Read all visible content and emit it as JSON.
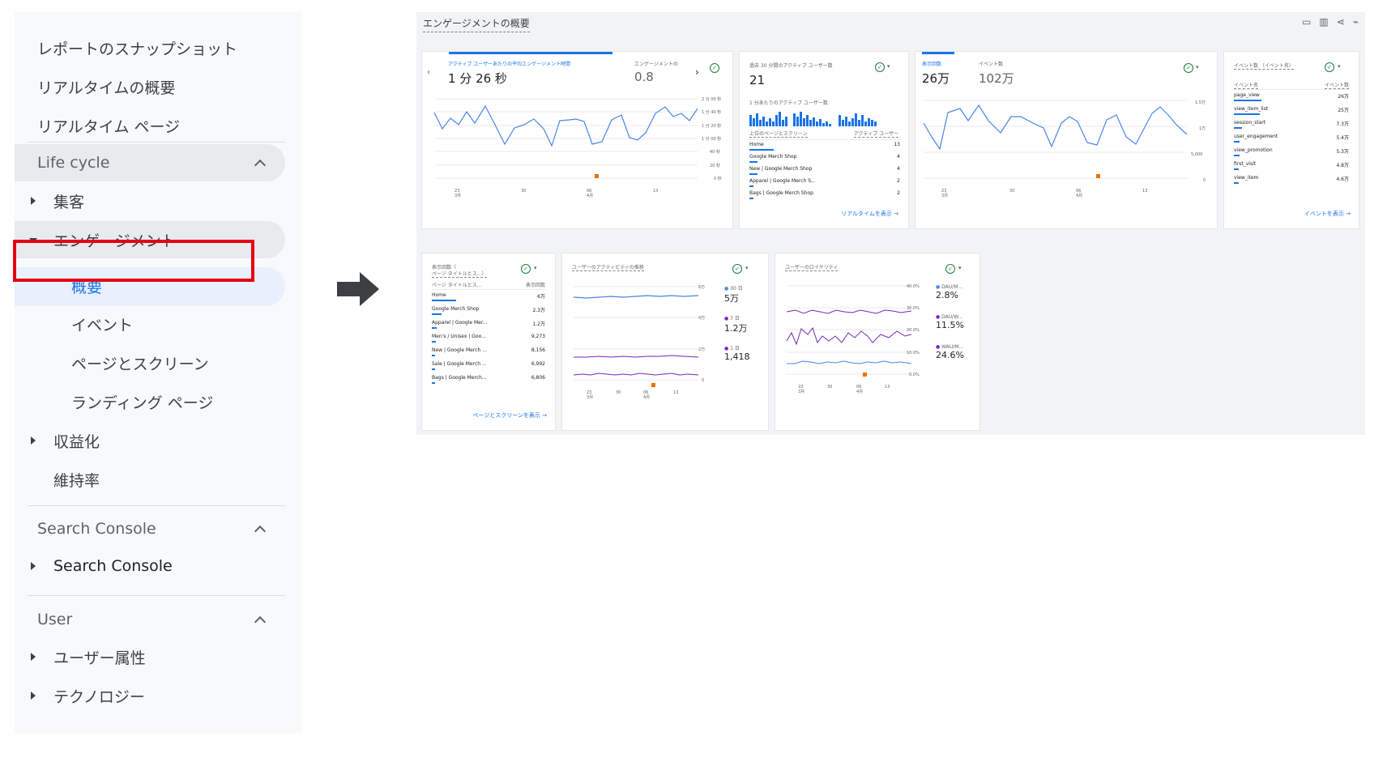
{
  "sidebar": {
    "top_items": [
      "レポートのスナップショット",
      "リアルタイムの概要",
      "リアルタイム ページ"
    ],
    "lifecycle": {
      "header": "Life cycle",
      "acquisition": "集客",
      "engagement": "エンゲージメント",
      "engagement_children": [
        "概要",
        "イベント",
        "ページとスクリーン",
        "ランディング ページ"
      ],
      "monetization": "収益化",
      "retention": "維持率"
    },
    "search_console": {
      "header": "Search Console",
      "item": "Search Console"
    },
    "user": {
      "header": "User",
      "items": [
        "ユーザー属性",
        "テクノロジー"
      ]
    }
  },
  "panel": {
    "title": "エンゲージメントの概要",
    "card1": {
      "metric1_label": "アクティブ ユーザーあたりの平均エンゲージメント時間",
      "metric1_value": "1 分 26 秒",
      "metric2_label": "エンゲージメントの",
      "metric2_value": "0.8",
      "y_ticks": [
        "2 分 00 秒",
        "1 分 40 秒",
        "1 分 20 秒",
        "1 分 00 秒",
        "40 秒",
        "20 秒",
        "0 秒"
      ],
      "x_ticks": [
        "23",
        "30",
        "06",
        "13"
      ],
      "x_sub": [
        "3月",
        "4月"
      ]
    },
    "card2": {
      "title": "過去 30 分間のアクティブ ユーザー数",
      "value": "21",
      "sub_title": "1 分あたりのアクティブ ユーザー数",
      "col1": "上位のページとスクリーン",
      "col2": "アクティブ ユーザー",
      "rows": [
        {
          "name": "Home",
          "value": "13"
        },
        {
          "name": "Google Merch Shop",
          "value": "4"
        },
        {
          "name": "New | Google Merch Shop",
          "value": "4"
        },
        {
          "name": "Apparel | Google Merch S...",
          "value": "2"
        },
        {
          "name": "Bags | Google Merch Shop",
          "value": "2"
        }
      ],
      "link": "リアルタイムを表示"
    },
    "card3": {
      "metric1_label": "表示回数",
      "metric1_value": "26万",
      "metric2_label": "イベント数",
      "metric2_value": "102万",
      "y_ticks": [
        "1.5万",
        "1万",
        "5,000",
        "0"
      ],
      "x_ticks": [
        "23",
        "30",
        "06",
        "13"
      ],
      "x_sub": [
        "3月",
        "4月"
      ]
    },
    "card4": {
      "title": "イベント数 （イベント名）",
      "col1": "イベント名",
      "col2": "イベント数",
      "rows": [
        {
          "name": "page_view",
          "value": "26万"
        },
        {
          "name": "view_item_list",
          "value": "25万"
        },
        {
          "name": "session_start",
          "value": "7.3万"
        },
        {
          "name": "user_engagement",
          "value": "5.4万"
        },
        {
          "name": "view_promotion",
          "value": "5.3万"
        },
        {
          "name": "first_visit",
          "value": "4.8万"
        },
        {
          "name": "view_item",
          "value": "4.6万"
        }
      ],
      "link": "イベントを表示"
    },
    "card5": {
      "title_line1": "表示回数（",
      "title_line2": "ページ タイトルとス...）",
      "col1": "ページ タイトルとス...",
      "col2": "表示回数",
      "rows": [
        {
          "name": "Home",
          "value": "6万"
        },
        {
          "name": "Google Merch Shop",
          "value": "2.3万"
        },
        {
          "name": "Apparel | Google Mer...",
          "value": "1.2万"
        },
        {
          "name": "Men's / Unisex | Goo...",
          "value": "9,273"
        },
        {
          "name": "New | Google Merch ...",
          "value": "8,156"
        },
        {
          "name": "Sale | Google Merch ...",
          "value": "6,992"
        },
        {
          "name": "Bags | Google Merch...",
          "value": "6,806"
        }
      ],
      "link": "ページとスクリーンを表示"
    },
    "card6": {
      "title": "ユーザーのアクティビティの推移",
      "y_ticks": [
        "6万",
        "4万",
        "2万",
        "0"
      ],
      "legend": [
        {
          "label": "30 日",
          "value": "5万"
        },
        {
          "label": "7 日",
          "value": "1.2万"
        },
        {
          "label": "1 日",
          "value": "1,418"
        }
      ],
      "x_ticks": [
        "23",
        "30",
        "06",
        "13"
      ],
      "x_sub": [
        "3月",
        "4月"
      ]
    },
    "card7": {
      "title": "ユーザーのロイヤリティ",
      "y_ticks": [
        "40.0%",
        "30.0%",
        "20.0%",
        "10.0%",
        "0.0%"
      ],
      "legend": [
        {
          "label": "DAU/M...",
          "value": "2.8%"
        },
        {
          "label": "DAU/W...",
          "value": "11.5%"
        },
        {
          "label": "WAU/M...",
          "value": "24.6%"
        }
      ],
      "x_ticks": [
        "23",
        "30",
        "06",
        "13"
      ],
      "x_sub": [
        "3月",
        "4月"
      ]
    }
  },
  "colors": {
    "accent": "#1a73e8",
    "highlight": "#e60012",
    "purple": "#7627bb",
    "anomaly": "#e8710a"
  }
}
